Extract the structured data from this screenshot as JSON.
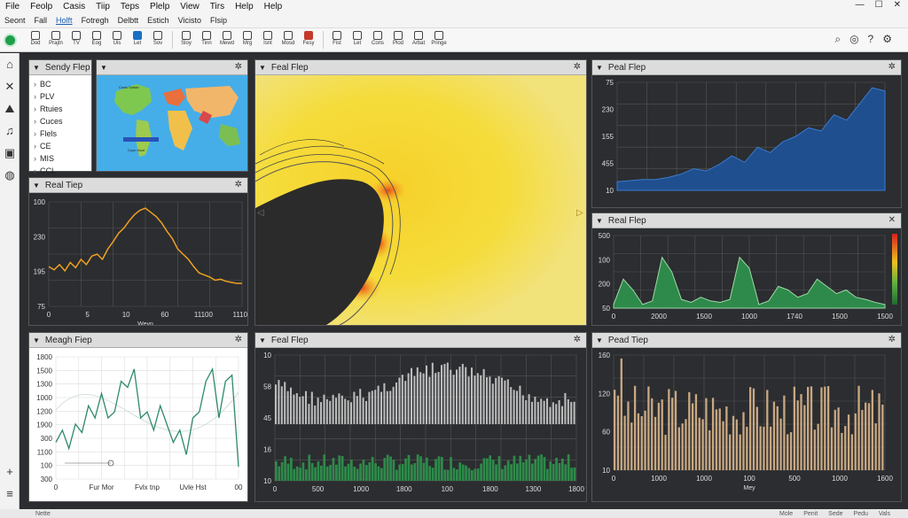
{
  "menu": [
    "File",
    "Feolp",
    "Casis",
    "Tiip",
    "Teps",
    "Plelp",
    "View",
    "Tirs",
    "Help",
    "Help"
  ],
  "menu2": [
    "Seont",
    "Fall",
    "Holft",
    "Fotregh",
    "Delbtt",
    "Estich",
    "Vicisto",
    "Flsip"
  ],
  "menu2_active": 2,
  "window_controls": [
    "—",
    "☐",
    "✕"
  ],
  "toolbar": [
    "Dod",
    "Prajtn",
    "TV",
    "Eog",
    "Uis",
    "Let",
    "Sov",
    "Sloy",
    "Tinn",
    "Mewd",
    "Mrg",
    "Isnt",
    "Mosd",
    "Fesy",
    "Fist",
    "Let",
    "Cons",
    "Plod",
    "Arbat",
    "Pringe"
  ],
  "toolbar_right": [
    "search-icon",
    "target-icon",
    "help-icon",
    "gear-icon"
  ],
  "sidebar": [
    "home-icon",
    "close-icon",
    "map-icon",
    "note-icon",
    "image-icon",
    "globe-icon"
  ],
  "sidebar_bottom": [
    "plus-icon",
    "menu-icon"
  ],
  "panels": {
    "sendy": {
      "title": "Sendy Flep",
      "items": [
        "BC",
        "PLV",
        "Rtuies",
        "Cuces",
        "Flels",
        "CE",
        "MIS",
        "CCL"
      ]
    },
    "map": {
      "title": "",
      "labels": [
        "Cosis Sotiad",
        "Coyn Haot"
      ]
    },
    "real1": {
      "title": "Real Tiep"
    },
    "heat": {
      "title": "Feal Flep"
    },
    "real2": {
      "title": "Peal Flep"
    },
    "real3": {
      "title": "Real Flep"
    },
    "meagh": {
      "title": "Meagh Fiep"
    },
    "feal": {
      "title": "Feal Flep"
    },
    "pead": {
      "title": "Pead Tiep"
    }
  },
  "status": {
    "left": "Nette",
    "right": [
      "Mole",
      "Penit",
      "Sede",
      "Pedu",
      "Vals"
    ]
  },
  "chart_data": [
    {
      "name": "real-tiep",
      "type": "line",
      "x_ticks": [
        "0",
        "5",
        "10",
        "60",
        "11100",
        "11100"
      ],
      "y_ticks": [
        "100",
        "230",
        "195",
        "75"
      ],
      "xlabel": "Weyn",
      "values": [
        0.62,
        0.65,
        0.6,
        0.66,
        0.58,
        0.63,
        0.55,
        0.6,
        0.52,
        0.5,
        0.55,
        0.45,
        0.38,
        0.3,
        0.25,
        0.18,
        0.12,
        0.08,
        0.06,
        0.1,
        0.14,
        0.2,
        0.28,
        0.35,
        0.45,
        0.5,
        0.55,
        0.62,
        0.68,
        0.7,
        0.72,
        0.75,
        0.74,
        0.76,
        0.77,
        0.78,
        0.78
      ]
    },
    {
      "name": "peal-flep",
      "type": "area",
      "y_ticks": [
        "75",
        "230",
        "155",
        "455",
        "10"
      ],
      "values": [
        0.92,
        0.91,
        0.9,
        0.9,
        0.88,
        0.85,
        0.8,
        0.82,
        0.76,
        0.68,
        0.74,
        0.6,
        0.65,
        0.55,
        0.5,
        0.42,
        0.45,
        0.3,
        0.35,
        0.2,
        0.05,
        0.08
      ]
    },
    {
      "name": "real-flep",
      "type": "area",
      "x_ticks": [
        "0",
        "2000",
        "1500",
        "1000",
        "1740",
        "1500",
        "1500"
      ],
      "y_ticks": [
        "500",
        "100",
        "200",
        "50"
      ],
      "values": [
        0.95,
        0.6,
        0.75,
        0.95,
        0.9,
        0.3,
        0.5,
        0.88,
        0.92,
        0.85,
        0.9,
        0.92,
        0.88,
        0.3,
        0.45,
        0.95,
        0.9,
        0.7,
        0.75,
        0.85,
        0.8,
        0.6,
        0.7,
        0.8,
        0.75,
        0.85,
        0.88,
        0.92,
        0.95
      ]
    },
    {
      "name": "meagh-fiep",
      "type": "line",
      "x_ticks": [
        "0",
        "Fur Mor",
        "Fvlx tnp",
        "Uvle Hst",
        "00"
      ],
      "y_ticks": [
        "1800",
        "1500",
        "1300",
        "1000",
        "1200",
        "1900",
        "300",
        "1100",
        "100",
        "300"
      ],
      "values": [
        0.7,
        0.6,
        0.75,
        0.55,
        0.62,
        0.4,
        0.5,
        0.3,
        0.5,
        0.45,
        0.2,
        0.25,
        0.1,
        0.5,
        0.45,
        0.6,
        0.4,
        0.55,
        0.7,
        0.6,
        0.8,
        0.5,
        0.45,
        0.2,
        0.1,
        0.5,
        0.2,
        0.15,
        0.9
      ]
    },
    {
      "name": "feal-flep",
      "type": "bar",
      "x_ticks": [
        "0",
        "500",
        "1000",
        "1800",
        "100",
        "1800",
        "1300",
        "1800"
      ],
      "y_ticks": [
        "10",
        "58",
        "45",
        "16",
        "10"
      ],
      "seed": 7
    },
    {
      "name": "pead-tiep",
      "type": "bar",
      "x_ticks": [
        "0",
        "1000",
        "1000",
        "100",
        "500",
        "1000",
        "1600"
      ],
      "y_ticks": [
        "160",
        "120",
        "60",
        "10"
      ],
      "xlabel": "Mey",
      "seed": 3
    }
  ]
}
